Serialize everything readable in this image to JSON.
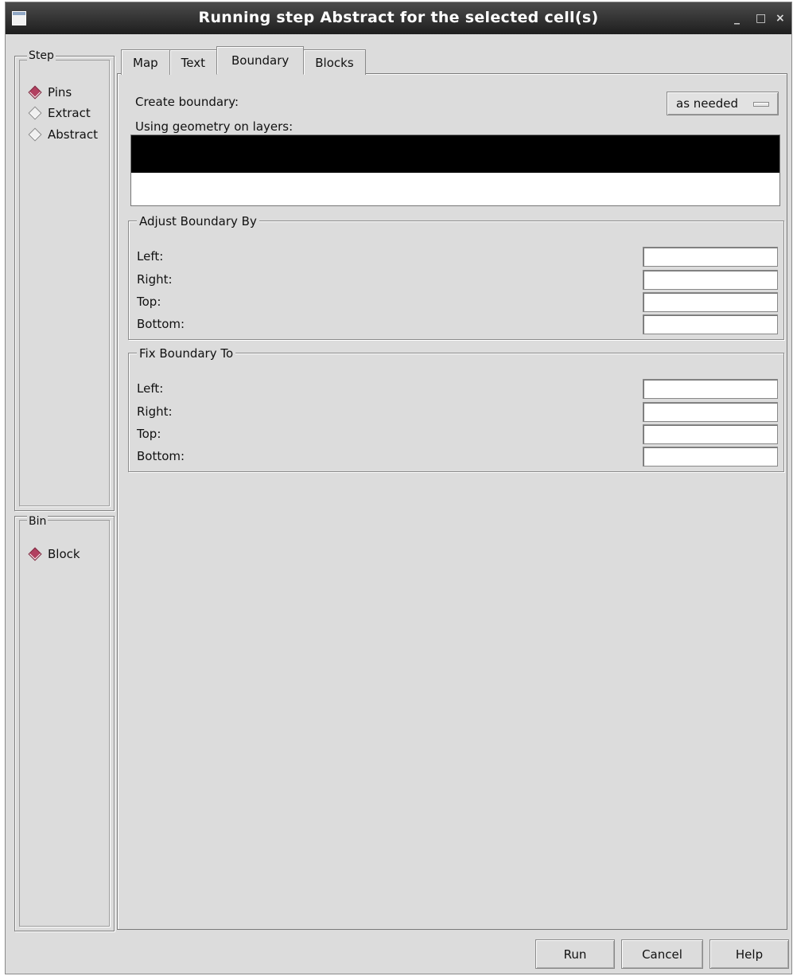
{
  "window": {
    "title": "Running step Abstract for the selected cell(s)",
    "controls": {
      "minimize": "_",
      "maximize": "□",
      "close": "×"
    }
  },
  "step_group": {
    "legend": "Step",
    "options": [
      {
        "label": "Pins",
        "selected": true
      },
      {
        "label": "Extract",
        "selected": false
      },
      {
        "label": "Abstract",
        "selected": false
      }
    ]
  },
  "bin_group": {
    "legend": "Bin",
    "options": [
      {
        "label": "Block",
        "selected": true
      }
    ]
  },
  "tabs": [
    {
      "label": "Map",
      "active": false
    },
    {
      "label": "Text",
      "active": false
    },
    {
      "label": "Boundary",
      "active": true
    },
    {
      "label": "Blocks",
      "active": false
    }
  ],
  "boundary": {
    "create_label": "Create boundary:",
    "create_value": "as needed",
    "layers_label": "Using geometry on layers:",
    "adjust": {
      "legend": "Adjust Boundary By",
      "fields": [
        {
          "label": "Left:",
          "value": ""
        },
        {
          "label": "Right:",
          "value": ""
        },
        {
          "label": "Top:",
          "value": ""
        },
        {
          "label": "Bottom:",
          "value": ""
        }
      ]
    },
    "fix": {
      "legend": "Fix Boundary To",
      "fields": [
        {
          "label": "Left:",
          "value": ""
        },
        {
          "label": "Right:",
          "value": ""
        },
        {
          "label": "Top:",
          "value": ""
        },
        {
          "label": "Bottom:",
          "value": ""
        }
      ]
    }
  },
  "buttons": {
    "run": "Run",
    "cancel": "Cancel",
    "help": "Help"
  },
  "colors": {
    "radio_selected": "#b24060",
    "titlebar": "#2b2b2b",
    "background": "#dcdcdc"
  }
}
